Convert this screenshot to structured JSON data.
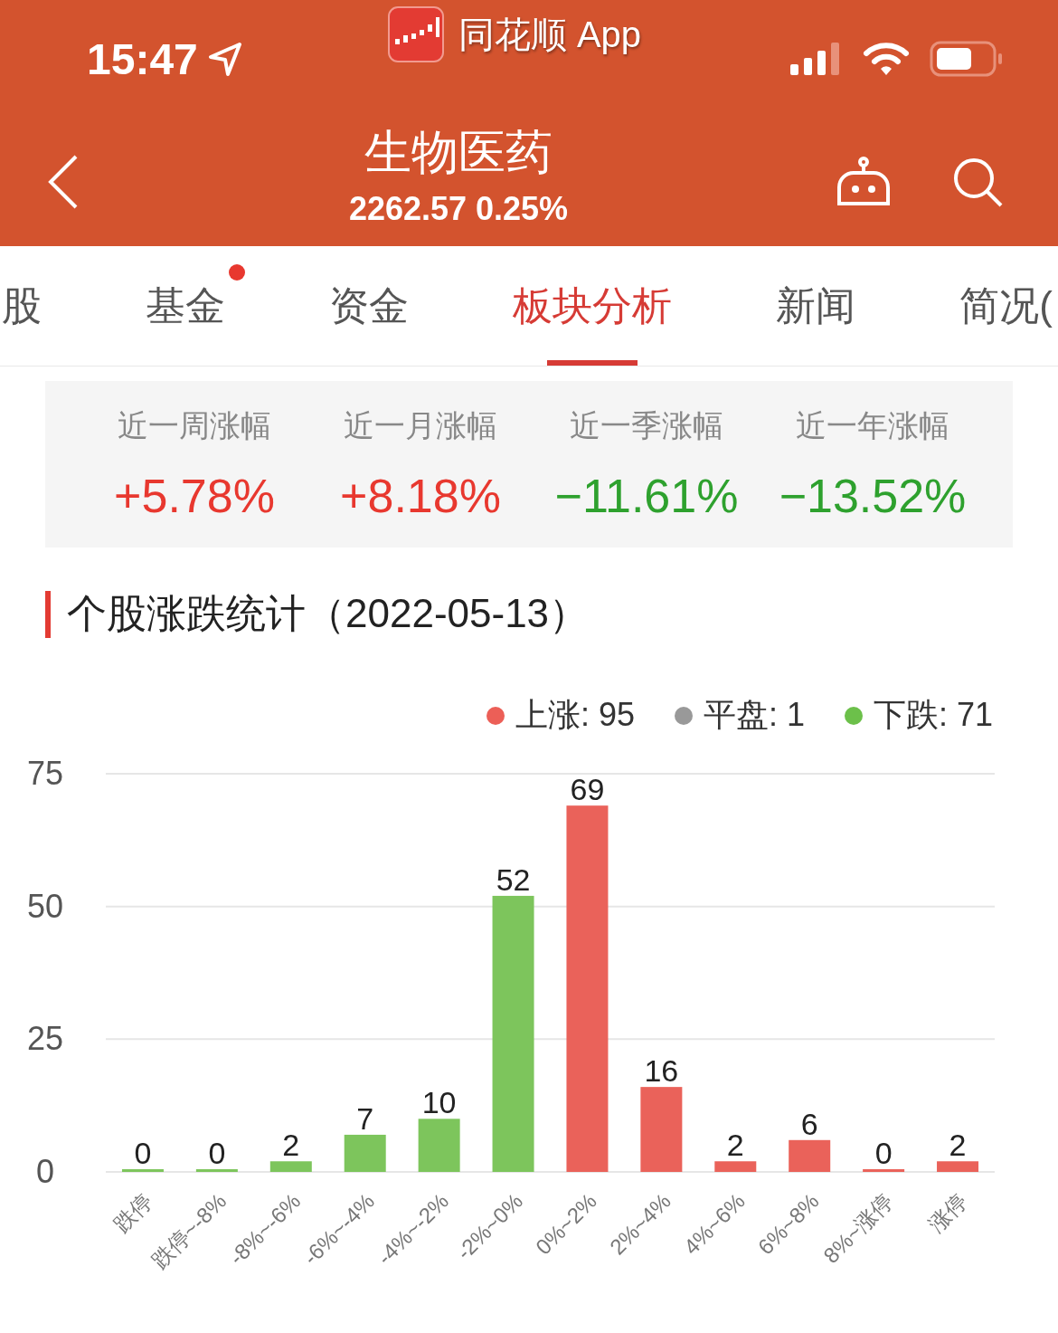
{
  "status_bar": {
    "time": "15:47",
    "app_title": "同花顺 App"
  },
  "header": {
    "title": "生物医药",
    "subtitle": "2262.57 0.25%"
  },
  "tabs": [
    {
      "label": "股",
      "selected": false,
      "dot": false
    },
    {
      "label": "基金",
      "selected": false,
      "dot": true
    },
    {
      "label": "资金",
      "selected": false,
      "dot": false
    },
    {
      "label": "板块分析",
      "selected": true,
      "dot": false
    },
    {
      "label": "新闻",
      "selected": false,
      "dot": false
    },
    {
      "label": "简况(",
      "selected": false,
      "dot": false
    }
  ],
  "stats": [
    {
      "label": "近一周涨幅",
      "value": "+5.78%",
      "color": "#e8382f"
    },
    {
      "label": "近一月涨幅",
      "value": "+8.18%",
      "color": "#e8382f"
    },
    {
      "label": "近一季涨幅",
      "value": "−11.61%",
      "color": "#2ea12e"
    },
    {
      "label": "近一年涨幅",
      "value": "−13.52%",
      "color": "#2ea12e"
    }
  ],
  "section_title": "个股涨跌统计（2022-05-13）",
  "legend": [
    {
      "label": "上涨: 95",
      "color": "#ec5f57"
    },
    {
      "label": "平盘: 1",
      "color": "#999999"
    },
    {
      "label": "下跌: 71",
      "color": "#6cc04a"
    }
  ],
  "chart_data": {
    "type": "bar",
    "categories": [
      "跌停",
      "跌停~-8%",
      "-8%~-6%",
      "-6%~-4%",
      "-4%~-2%",
      "-2%~0%",
      "0%~2%",
      "2%~4%",
      "4%~6%",
      "6%~8%",
      "8%~涨停",
      "涨停"
    ],
    "series": [
      {
        "color": "#7dc55c",
        "values": [
          0,
          0,
          2,
          7,
          10,
          52,
          null,
          null,
          null,
          null,
          null,
          null
        ]
      },
      {
        "color": "#ea625a",
        "values": [
          null,
          null,
          null,
          null,
          null,
          null,
          69,
          16,
          2,
          6,
          0,
          2
        ]
      }
    ],
    "ylim": [
      0,
      75
    ],
    "yticks": [
      0,
      25,
      50,
      75
    ],
    "stacked": true,
    "data_labels": true
  }
}
